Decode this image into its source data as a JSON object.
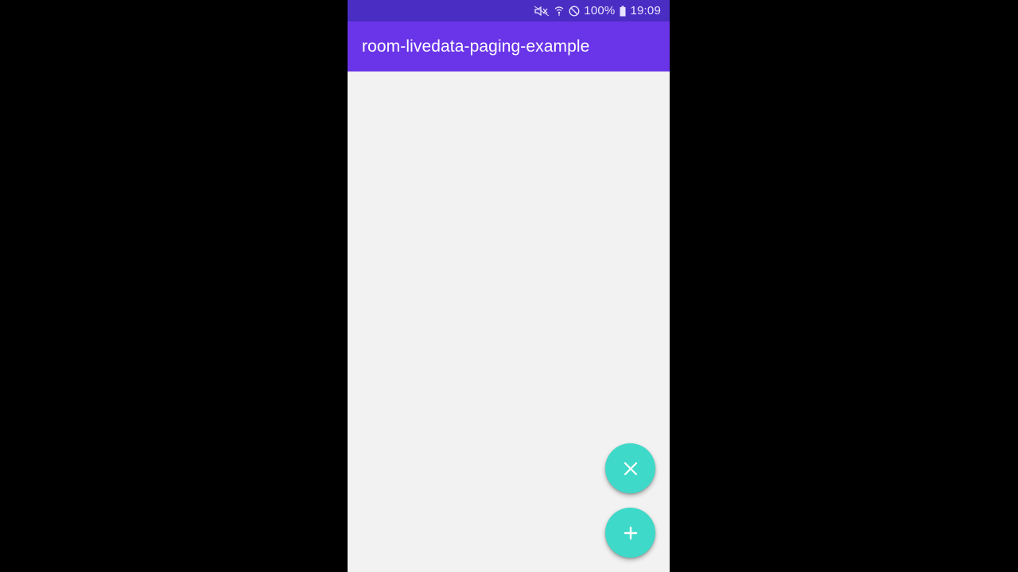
{
  "status_bar": {
    "icons": [
      "mute-icon",
      "wifi-icon",
      "do-not-disturb-icon"
    ],
    "battery_percent": "100%",
    "battery_icon": "battery-icon",
    "time": "19:09",
    "background": "#4a2ec4"
  },
  "app_bar": {
    "title": "room-livedata-paging-example",
    "background": "#6a35e8"
  },
  "content": {
    "background": "#f2f2f2"
  },
  "fabs": [
    {
      "icon": "close-icon",
      "color": "#3fd9c9"
    },
    {
      "icon": "add-icon",
      "color": "#3fd9c9"
    }
  ]
}
